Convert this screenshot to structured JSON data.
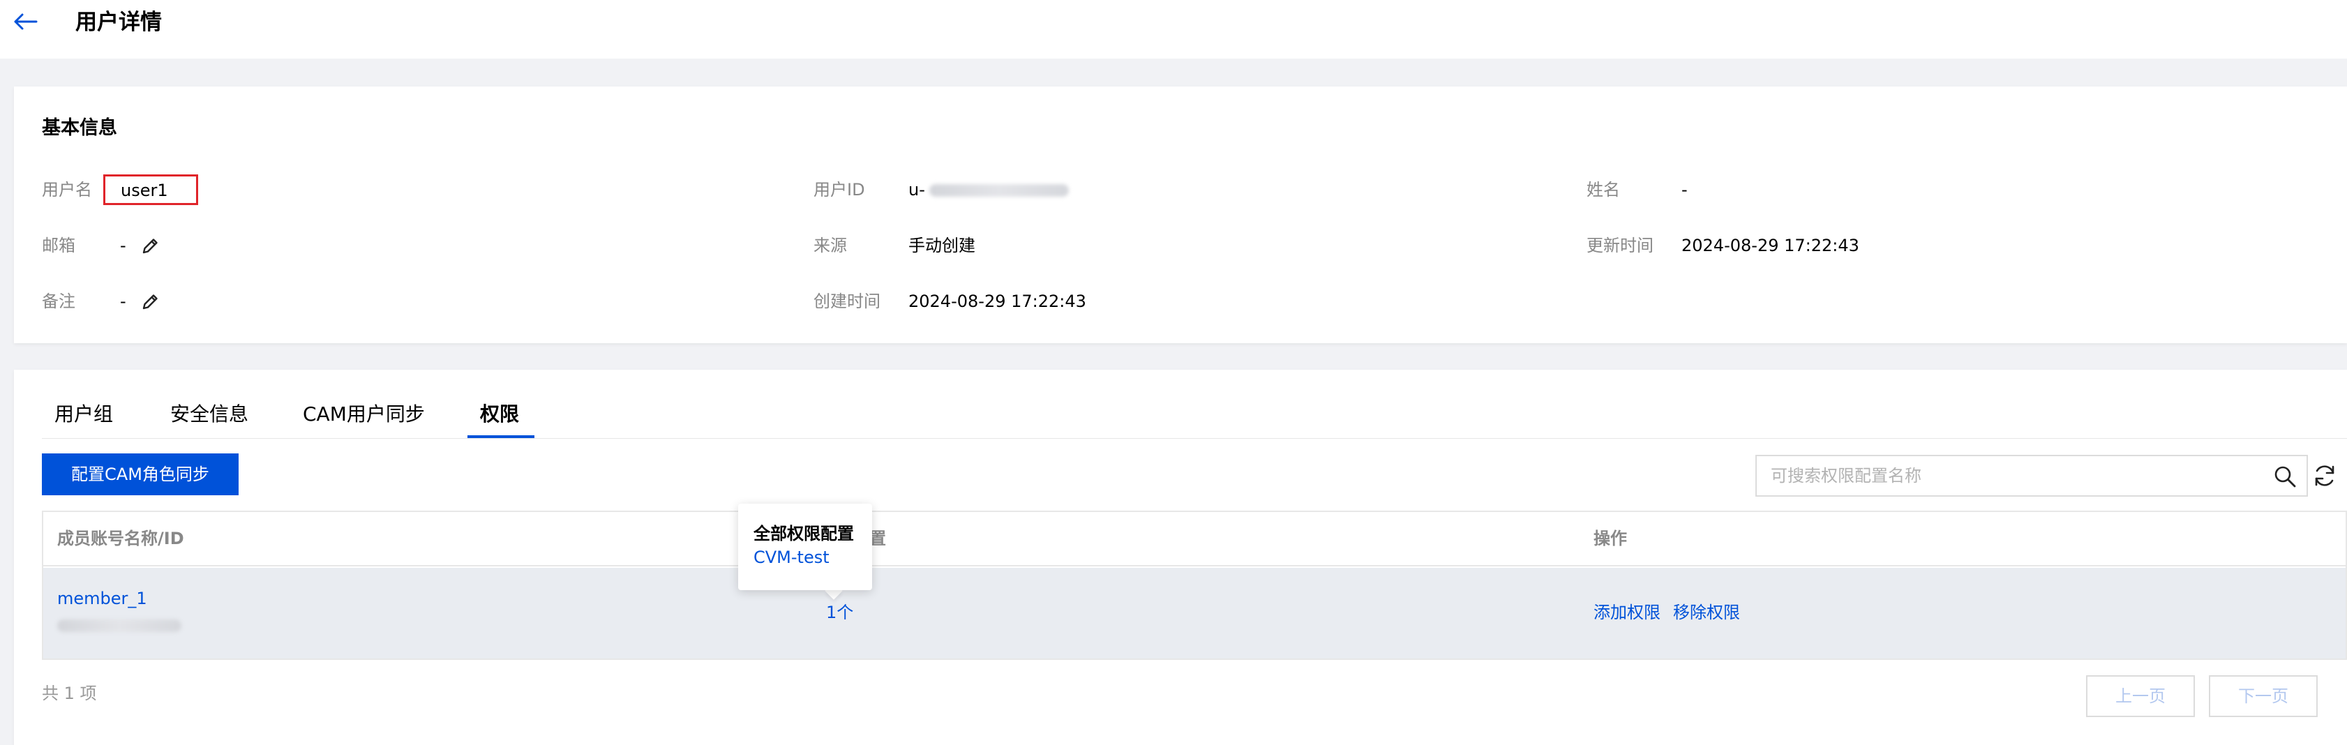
{
  "header": {
    "back_icon": "arrow-left-icon",
    "title": "用户详情"
  },
  "basic_info": {
    "title": "基本信息",
    "fields": {
      "username_label": "用户名",
      "username_value": "user1",
      "email_label": "邮箱",
      "email_value": "-",
      "note_label": "备注",
      "note_value": "-",
      "user_id_label": "用户ID",
      "user_id_value": "u-",
      "source_label": "来源",
      "source_value": "手动创建",
      "created_label": "创建时间",
      "created_value": "2024-08-29 17:22:43",
      "name_label": "姓名",
      "name_value": "-",
      "updated_label": "更新时间",
      "updated_value": "2024-08-29 17:22:43"
    }
  },
  "tabs": [
    {
      "label": "用户组",
      "active": false
    },
    {
      "label": "安全信息",
      "active": false
    },
    {
      "label": "CAM用户同步",
      "active": false
    },
    {
      "label": "权限",
      "active": true
    }
  ],
  "toolbar": {
    "primary_button": "配置CAM角色同步",
    "search_placeholder": "可搜索权限配置名称"
  },
  "table": {
    "headers": {
      "member": "成员账号名称/ID",
      "config_suffix": "置",
      "actions": "操作"
    },
    "rows": [
      {
        "member_name": "member_1",
        "permission_count": "1个",
        "action_add": "添加权限",
        "action_remove": "移除权限"
      }
    ]
  },
  "popover": {
    "title": "全部权限配置",
    "item": "CVM-test"
  },
  "pagination": {
    "total": "共 1 项",
    "prev": "上一页",
    "next": "下一页"
  },
  "colors": {
    "primary": "#0052d9",
    "highlight_border": "#e0242a",
    "page_bg": "#f1f2f5",
    "row_bg": "#e9ecf1"
  }
}
